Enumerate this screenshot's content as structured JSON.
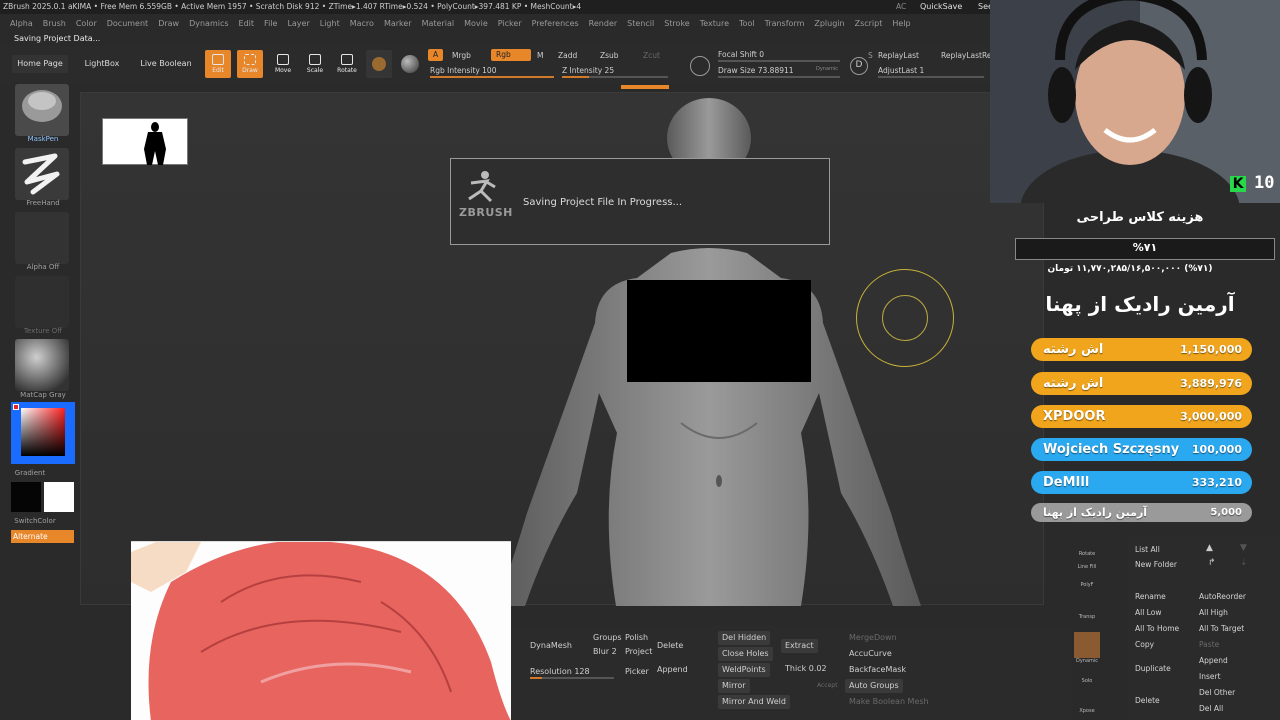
{
  "titlebar": {
    "text": "ZBrush 2025.0.1   aKIMA   • Free Mem 6.559GB • Active Mem 1957 • Scratch Disk 912 • ZTime▸1.407 RTime▸0.524 • PolyCount▸397.481 KP • MeshCount▸4",
    "ac": "AC",
    "quicksave": "QuickSave",
    "see": "See"
  },
  "menu": [
    "Alpha",
    "Brush",
    "Color",
    "Document",
    "Draw",
    "Dynamics",
    "Edit",
    "File",
    "Layer",
    "Light",
    "Macro",
    "Marker",
    "Material",
    "Movie",
    "Picker",
    "Preferences",
    "Render",
    "Stencil",
    "Stroke",
    "Texture",
    "Tool",
    "Transform",
    "Zplugin",
    "Zscript",
    "Help"
  ],
  "status": "Saving Project Data...",
  "shelf": {
    "home": "Home Page",
    "lightbox": "LightBox",
    "liveboolean": "Live Boolean",
    "edit": "Edit",
    "draw": "Draw",
    "move": "Move",
    "scale": "Scale",
    "rotate": "Rotate",
    "a": "A",
    "mrgb": "Mrgb",
    "rgb": "Rgb",
    "m": "M",
    "zadd": "Zadd",
    "zsub": "Zsub",
    "zcut": "Zcut",
    "rgb_intensity": "Rgb Intensity 100",
    "z_intensity": "Z Intensity 25",
    "focal_shift": "Focal Shift 0",
    "draw_size": "Draw Size 73.88911",
    "dynamic": "Dynamic",
    "d": "D",
    "s": "S",
    "replaylast": "ReplayLast",
    "replaylastrel": "ReplayLastRel",
    "adjustlast": "AdjustLast 1"
  },
  "progress": {
    "rgb_intensity": 1.0,
    "z_intensity": 0.25
  },
  "lefttray": {
    "maskpen": "MaskPen",
    "freehand": "FreeHand",
    "alpha_off": "Alpha Off",
    "texture_off": "Texture Off",
    "matcap": "MatCap Gray",
    "gradient": "Gradient",
    "switchcolor": "SwitchColor",
    "alternate": "Alternate"
  },
  "dialog": {
    "logo": "ZBRUSH",
    "message": "Saving Project File In Progress..."
  },
  "bottom": {
    "dynamesh": "DynaMesh",
    "groups": "Groups",
    "polish": "Polish",
    "blur": "Blur 2",
    "project": "Project",
    "resolution": "Resolution 128",
    "picker": "Picker",
    "delete": "Delete",
    "append": "Append",
    "del_hidden": "Del Hidden",
    "close_holes": "Close Holes",
    "weldpoints": "WeldPoints",
    "mirror": "Mirror",
    "mirror_and_weld": "Mirror And Weld",
    "extract": "Extract",
    "thick": "Thick 0.02",
    "accept": "Accept",
    "mergedown": "MergeDown",
    "accucurve": "AccuCurve",
    "backfacemask": "BackfaceMask",
    "auto_groups": "Auto Groups",
    "make_boolean_mesh": "Make Boolean Mesh"
  },
  "rightstrip": [
    "Rotate",
    "Line Fill",
    "PolyF",
    "Transp",
    "Dynamic",
    "Solo",
    "Xpose"
  ],
  "subtool": {
    "list_all": "List All",
    "new_folder": "New Folder",
    "rename": "Rename",
    "autoreorder": "AutoReorder",
    "all_low": "All Low",
    "all_high": "All High",
    "all_to_home": "All To Home",
    "all_to_target": "All To Target",
    "copy": "Copy",
    "paste": "Paste",
    "duplicate": "Duplicate",
    "append": "Append",
    "insert": "Insert",
    "delete": "Delete",
    "del_other": "Del Other",
    "del_all": "Del All"
  },
  "stream": {
    "kick_letter": "K",
    "viewer_count": "10",
    "goal_title": "هزینه کلاس طراحی",
    "goal_percent": "%۷۱",
    "goal_amount": "(%۷۱) ۱۱,۷۷۰,۲۸۵/۱۶,۵۰۰,۰۰۰ تومان",
    "top_title": "آرمین رادیک از پهنا",
    "donations": [
      {
        "name": "اش رشته",
        "amount": "1,150,000",
        "color": "#f0a51c"
      },
      {
        "name": "اش رشته",
        "amount": "3,889,976",
        "color": "#f0a51c"
      },
      {
        "name": "XPDOOR",
        "amount": "3,000,000",
        "color": "#f0a51c"
      },
      {
        "name": "Wojciech Szczęsny",
        "amount": "100,000",
        "color": "#2aa8f0"
      },
      {
        "name": "DeMIll",
        "amount": "333,210",
        "color": "#2aa8f0"
      },
      {
        "name": "آرمین رادیک از پهنا",
        "amount": "5,000",
        "color": "#9a9a9a"
      }
    ]
  },
  "colors": {
    "accent": "#e8862a",
    "kick": "#27d94a",
    "cursor": "#c8b23a"
  }
}
